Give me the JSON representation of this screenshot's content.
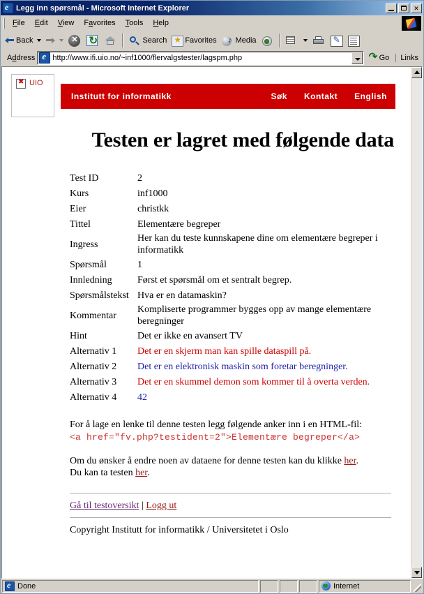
{
  "window": {
    "title": "Legg inn spørsmål - Microsoft Internet Explorer",
    "minimize_label": "Minimize",
    "maximize_label": "Maximize",
    "close_label": "✕"
  },
  "menubar": {
    "items": [
      "File",
      "Edit",
      "View",
      "Favorites",
      "Tools",
      "Help"
    ]
  },
  "toolbar": {
    "back": "Back",
    "forward": "",
    "stop": "",
    "refresh": "",
    "home": "",
    "search": "Search",
    "favorites": "Favorites",
    "media": "Media",
    "history": "",
    "mail": "",
    "print": "",
    "edit": "",
    "discuss": ""
  },
  "address": {
    "label": "Address",
    "url": "http://www.ifi.uio.no/~inf1000/flervalgstester/lagspm.php",
    "go": "Go",
    "links": "Links"
  },
  "site": {
    "logo_alt": "UIO",
    "banner_title": "Institutt for informatikk",
    "banner_links": [
      "Søk",
      "Kontakt",
      "English"
    ],
    "banner_color": "#cc0000"
  },
  "page": {
    "title": "Testen er lagret med følgende data",
    "rows": [
      {
        "label": "Test ID",
        "value": "2",
        "color": "black"
      },
      {
        "label": "Kurs",
        "value": "inf1000",
        "color": "black"
      },
      {
        "label": "Eier",
        "value": "christkk",
        "color": "black"
      },
      {
        "label": "Tittel",
        "value": "Elementære begreper",
        "color": "black"
      },
      {
        "label": "Ingress",
        "value": "Her kan du teste kunnskapene dine om elementære begreper i informatikk",
        "color": "black"
      },
      {
        "label": "Spørsmål",
        "value": "1",
        "color": "black"
      },
      {
        "label": "Innledning",
        "value": "Først et spørsmål om et sentralt begrep.",
        "color": "black"
      },
      {
        "label": "Spørsmålstekst",
        "value": "Hva er en datamaskin?",
        "color": "black"
      },
      {
        "label": "Kommentar",
        "value": "Kompliserte programmer bygges opp av mange elementære beregninger",
        "color": "black"
      },
      {
        "label": "Hint",
        "value": "Det er ikke en avansert TV",
        "color": "black"
      },
      {
        "label": "Alternativ 1",
        "value": "Det er en skjerm man kan spille dataspill på.",
        "color": "red"
      },
      {
        "label": "Alternativ 2",
        "value": "Det er en elektronisk maskin som foretar beregninger.",
        "color": "blue"
      },
      {
        "label": "Alternativ 3",
        "value": "Det er en skummel demon som kommer til å overta verden.",
        "color": "red"
      },
      {
        "label": "Alternativ 4",
        "value": "42",
        "color": "blue"
      }
    ],
    "anchor_intro": "For å lage en lenke til denne testen legg følgende anker inn i en HTML-fil:",
    "anchor_code": "<a href=\"fv.php?testident=2\">Elementære begreper</a>",
    "edit_text_before": "Om du ønsker å endre noen av dataene for denne testen kan du klikke ",
    "edit_link": "her",
    "edit_text_after": ".",
    "take_text_before": "Du kan ta testen ",
    "take_link": "her",
    "take_text_after": ".",
    "footer_link_overview": "Gå til testoversikt",
    "footer_separator": "|",
    "footer_link_logout": "Logg ut",
    "copyright": "Copyright Institutt for informatikk / Universitetet i Oslo",
    "colors": {
      "red_text": "#cc0000",
      "blue_text": "#2222aa",
      "code_red": "#cc3333",
      "link": "#9b1c1c",
      "visited_link": "#6b2a7a"
    }
  },
  "status": {
    "message": "Done",
    "zone": "Internet"
  }
}
